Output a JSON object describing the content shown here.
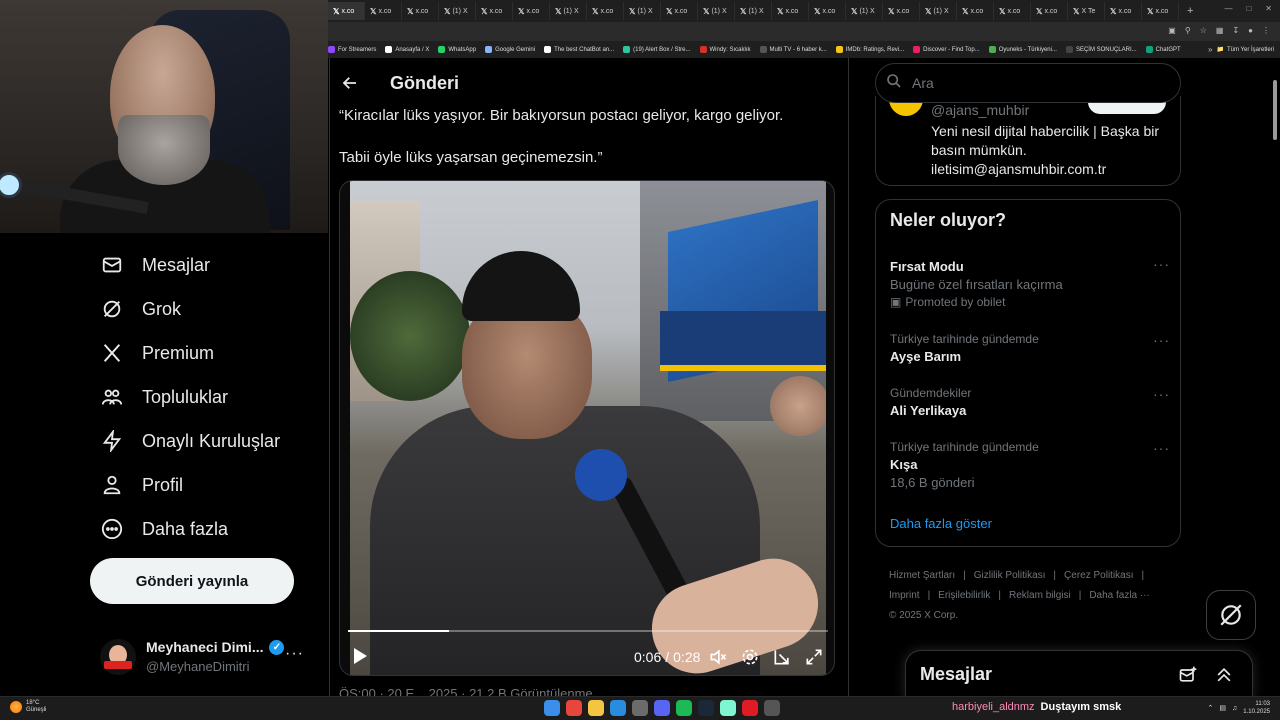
{
  "browser": {
    "tabs": [
      "x.co",
      "x.co",
      "x.co",
      "(1) X",
      "x.co",
      "x.co",
      "(1) X",
      "x.co",
      "(1) X",
      "x.co",
      "(1) X",
      "(1) X",
      "x.co",
      "x.co",
      "(1) X",
      "x.co",
      "(1) X",
      "x.co",
      "x.co",
      "x.co",
      "X Te",
      "x.co",
      "x.co"
    ],
    "bookmarks": [
      {
        "label": "For Streamers",
        "color": "#9146ff"
      },
      {
        "label": "Anasayfa / X",
        "color": "#ffffff"
      },
      {
        "label": "WhatsApp",
        "color": "#25d366"
      },
      {
        "label": "Google Gemini",
        "color": "#8ab4f8"
      },
      {
        "label": "The best ChatBot an...",
        "color": "#ffffff"
      },
      {
        "label": "(19) Alert Box / Stre...",
        "color": "#31c3a2"
      },
      {
        "label": "Windy: Sıcaklık",
        "color": "#d93025"
      },
      {
        "label": "Multi TV - 6 haber k...",
        "color": "#555555"
      },
      {
        "label": "IMDb: Ratings, Revi...",
        "color": "#f5c518"
      },
      {
        "label": "Discover - Find Top...",
        "color": "#e91e63"
      },
      {
        "label": "Oyuneks - Türkiyeni...",
        "color": "#4caf50"
      },
      {
        "label": "SEÇİM SONUÇLARI...",
        "color": "#444444"
      },
      {
        "label": "ChatGPT",
        "color": "#10a37f"
      }
    ],
    "bookmarks_right": "Tüm Yer İşaretleri"
  },
  "nav": {
    "items": [
      {
        "label": "Mesajlar",
        "icon": "envelope-icon"
      },
      {
        "label": "Grok",
        "icon": "grok-icon"
      },
      {
        "label": "Premium",
        "icon": "x-logo-icon"
      },
      {
        "label": "Topluluklar",
        "icon": "communities-icon"
      },
      {
        "label": "Onaylı Kuruluşlar",
        "icon": "lightning-icon"
      },
      {
        "label": "Profil",
        "icon": "person-icon"
      },
      {
        "label": "Daha fazla",
        "icon": "more-circle-icon"
      }
    ],
    "post_button": "Gönderi yayınla",
    "account": {
      "name": "Meyhaneci Dimi...",
      "handle": "@MeyhaneDimitri",
      "more": "···"
    }
  },
  "main": {
    "title": "Gönderi",
    "text_line1": "“Kiracılar lüks yaşıyor. Bir bakıyorsun postacı geliyor, kargo geliyor.",
    "text_line2": "Tabii öyle lüks yaşarsan geçinemezsin.”",
    "video": {
      "current_time": "0:06",
      "separator": "/",
      "duration": "0:28",
      "progress": 0.21
    },
    "meta_partial": "ÖS:00 · 20 E... 2025 · 21,2 B Görüntülenme"
  },
  "right": {
    "search_placeholder": "Ara",
    "profile": {
      "handle": "@ajans_muhbir",
      "bio": "Yeni nesil dijital habercilik | Başka bir basın mümkün. iletisim@ajansmuhbir.com.tr"
    },
    "trends_title": "Neler oluyor?",
    "trends": [
      {
        "context": "",
        "name": "Fırsat Modu",
        "sub": "Bugüne özel fırsatları kaçırma",
        "promo": "Promoted by obilet"
      },
      {
        "context": "Türkiye tarihinde gündemde",
        "name": "Ayşe Barım",
        "sub": "",
        "promo": ""
      },
      {
        "context": "Gündemdekiler",
        "name": "Ali Yerlikaya",
        "sub": "",
        "promo": ""
      },
      {
        "context": "Türkiye tarihinde gündemde",
        "name": "Kışa",
        "sub": "18,6 B gönderi",
        "promo": ""
      }
    ],
    "show_more": "Daha fazla göster",
    "footer": [
      "Hizmet Şartları",
      "Gizlilik Politikası",
      "Çerez Politikası",
      "Imprint",
      "Erişilebilirlik",
      "Reklam bilgisi",
      "Daha fazla ···",
      "© 2025 X Corp."
    ],
    "messages_title": "Mesajlar"
  },
  "taskbar": {
    "weather_temp": "18°C",
    "weather_desc": "Güneşli",
    "chat_user": "harbiyeli_aldnmz",
    "chat_message": "Duştayım smsk",
    "time": "11:03",
    "date": "1.10.2025",
    "apps": [
      {
        "name": "windows-start-icon",
        "color": "#3b8eea"
      },
      {
        "name": "chrome-icon",
        "color": "#e8453c"
      },
      {
        "name": "explorer-icon",
        "color": "#f4c542"
      },
      {
        "name": "edge-icon",
        "color": "#2a8cde"
      },
      {
        "name": "obs-icon",
        "color": "#6b6b6b"
      },
      {
        "name": "discord-icon",
        "color": "#5865f2"
      },
      {
        "name": "spotify-icon",
        "color": "#1db954"
      },
      {
        "name": "steam-icon",
        "color": "#1b2838"
      },
      {
        "name": "streamlabs-icon",
        "color": "#80f5d2"
      },
      {
        "name": "opera-icon",
        "color": "#e01b24"
      },
      {
        "name": "vpn-icon",
        "color": "#555555"
      }
    ]
  }
}
